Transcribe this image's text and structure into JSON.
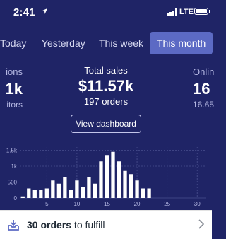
{
  "status": {
    "time": "2:41",
    "network": "LTE"
  },
  "tabs": [
    "Today",
    "Yesterday",
    "This week",
    "This month"
  ],
  "active_tab": "This month",
  "metrics": {
    "left": {
      "label": "ions",
      "value": "1k",
      "sub": "itors"
    },
    "center": {
      "label": "Total sales",
      "value": "$11.57k",
      "sub": "197 orders"
    },
    "right": {
      "label": "Onlin",
      "value": "16",
      "sub": "16.65"
    }
  },
  "view_dashboard": "View dashboard",
  "chart_data": {
    "type": "bar",
    "x": [
      1,
      2,
      3,
      4,
      5,
      6,
      7,
      8,
      9,
      10,
      11,
      12,
      13,
      14,
      15,
      16,
      17,
      18,
      19,
      20,
      21,
      22,
      23,
      24,
      25,
      26,
      27,
      28,
      29,
      30,
      31
    ],
    "values": [
      50,
      300,
      250,
      250,
      300,
      550,
      450,
      650,
      250,
      550,
      350,
      650,
      450,
      1150,
      1350,
      1450,
      1150,
      850,
      750,
      550,
      300,
      300,
      0,
      0,
      0,
      0,
      0,
      0,
      0,
      0,
      0
    ],
    "ylim": [
      0,
      1600
    ],
    "yticks": [
      "1.5k",
      "1k",
      "500",
      "0"
    ],
    "xticks": [
      "5",
      "10",
      "15",
      "20",
      "25",
      "30"
    ],
    "grid": true
  },
  "footer": {
    "bold": "30 orders",
    "rest": " to fulfill"
  },
  "colors": {
    "background": "#1f2466",
    "active_tab": "#5c6ac4",
    "bars": "#ffffff"
  }
}
